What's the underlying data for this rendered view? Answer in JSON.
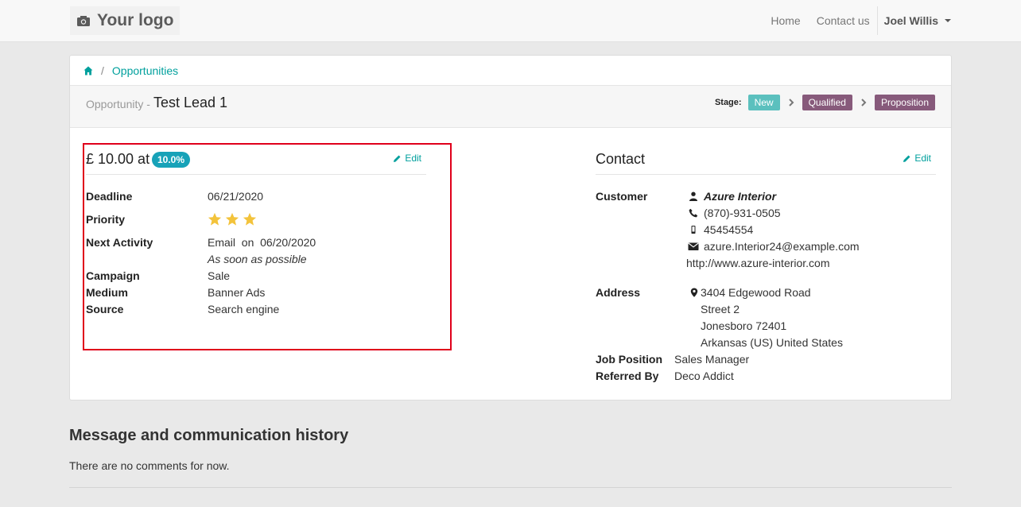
{
  "navbar": {
    "logo_text": "Your logo",
    "links": [
      "Home",
      "Contact us"
    ],
    "user": "Joel Willis"
  },
  "breadcrumb": {
    "item": "Opportunities"
  },
  "header": {
    "type_label": "Opportunity -",
    "title": "Test Lead 1",
    "stage_label": "Stage:",
    "stages": [
      {
        "label": "New",
        "color": "#5bc0be"
      },
      {
        "label": "Qualified",
        "color": "#875a7b"
      },
      {
        "label": "Proposition",
        "color": "#875a7b"
      }
    ]
  },
  "summary": {
    "amount": "£ 10.00 at",
    "probability": "10.0%",
    "edit_label": "Edit",
    "deadline_label": "Deadline",
    "deadline": "06/21/2020",
    "priority_label": "Priority",
    "priority_stars": 3,
    "next_activity_label": "Next Activity",
    "next_activity": "Email  on  06/20/2020",
    "next_activity_note": "As soon as possible",
    "campaign_label": "Campaign",
    "campaign": "Sale",
    "medium_label": "Medium",
    "medium": "Banner Ads",
    "source_label": "Source",
    "source": "Search engine"
  },
  "contact": {
    "title": "Contact",
    "edit_label": "Edit",
    "customer_label": "Customer",
    "customer_name": "Azure Interior",
    "phone": "(870)-931-0505",
    "mobile": "45454554",
    "email": "azure.Interior24@example.com",
    "website": "http://www.azure-interior.com",
    "address_label": "Address",
    "address_lines": [
      "3404 Edgewood Road",
      "Street 2",
      "Jonesboro 72401",
      "Arkansas (US) United States"
    ],
    "job_position_label": "Job Position",
    "job_position": "Sales Manager",
    "referred_by_label": "Referred By",
    "referred_by": "Deco Addict"
  },
  "history": {
    "title": "Message and communication history",
    "empty_text": "There are no comments for now."
  },
  "colors": {
    "accent": "#00a09d",
    "probability_badge": "#17a2b8",
    "star": "#f3c33b",
    "highlight": "#e0001b"
  }
}
